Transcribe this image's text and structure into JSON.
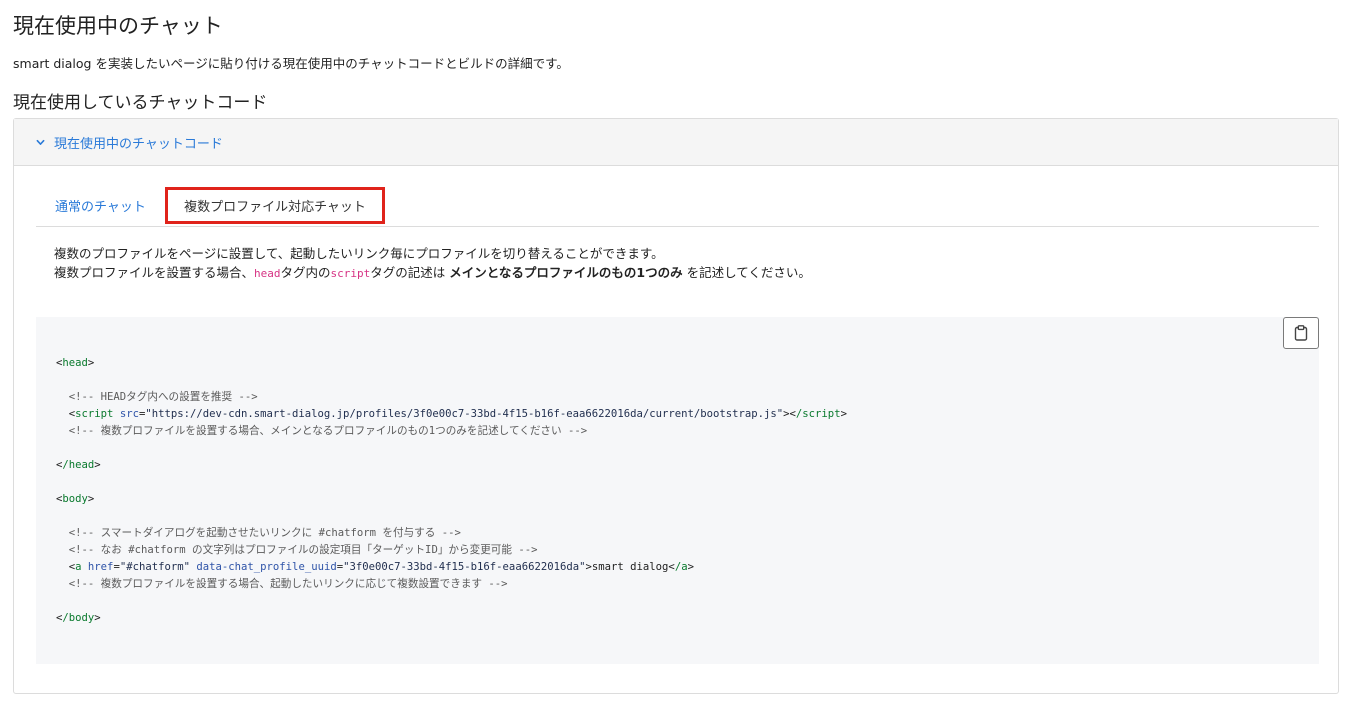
{
  "page": {
    "title": "現在使用中のチャット",
    "description": "smart dialog を実装したいページに貼り付ける現在使用中のチャットコードとビルドの詳細です。"
  },
  "section": {
    "title": "現在使用しているチャットコード"
  },
  "panel": {
    "header_label": "現在使用中のチャットコード",
    "tabs": [
      {
        "label": "通常のチャット"
      },
      {
        "label": "複数プロファイル対応チャット"
      }
    ],
    "desc": {
      "line1": "複数のプロファイルをページに設置して、起動したいリンク毎にプロファイルを切り替えることができます。",
      "line2_prefix": "複数プロファイルを設置する場合、",
      "code1": "head",
      "mid1": "タグ内の",
      "code2": "script",
      "mid2": "タグの記述は",
      "bold": "メインとなるプロファイルのもの1つのみ",
      "suffix": "を記述してください。"
    }
  },
  "code": {
    "head_open": "head",
    "comment1": "<!-- HEADタグ内への設置を推奨 -->",
    "script_tag": "script",
    "src_attr": "src",
    "src_value": "\"https://dev-cdn.smart-dialog.jp/profiles/3f0e00c7-33bd-4f15-b16f-eaa6622016da/current/bootstrap.js\"",
    "script_close": "/script",
    "comment2": "<!-- 複数プロファイルを設置する場合、メインとなるプロファイルのもの1つのみを記述してください -->",
    "head_close": "/head",
    "body_open": "body",
    "comment3": "<!-- スマートダイアログを起動させたいリンクに #chatform を付与する -->",
    "comment4": "<!-- なお #chatform の文字列はプロファイルの設定項目「ターゲットID」から変更可能 -->",
    "a_tag": "a",
    "href_attr": "href",
    "href_value": "\"#chatform\"",
    "uuid_attr": "data-chat_profile_uuid",
    "uuid_value": "\"3f0e00c7-33bd-4f15-b16f-eaa6622016da\"",
    "link_text": "smart dialog",
    "a_close": "/a",
    "comment5": "<!-- 複数プロファイルを設置する場合、起動したいリンクに応じて複数設置できます -->",
    "body_close": "/body"
  },
  "icons": {
    "header_toggle": "chevron-down-icon",
    "copy": "clipboard-icon"
  },
  "colors": {
    "link": "#2a7ad8",
    "tab_highlight": "#e0231b",
    "code_bg": "#f6f7f9"
  }
}
